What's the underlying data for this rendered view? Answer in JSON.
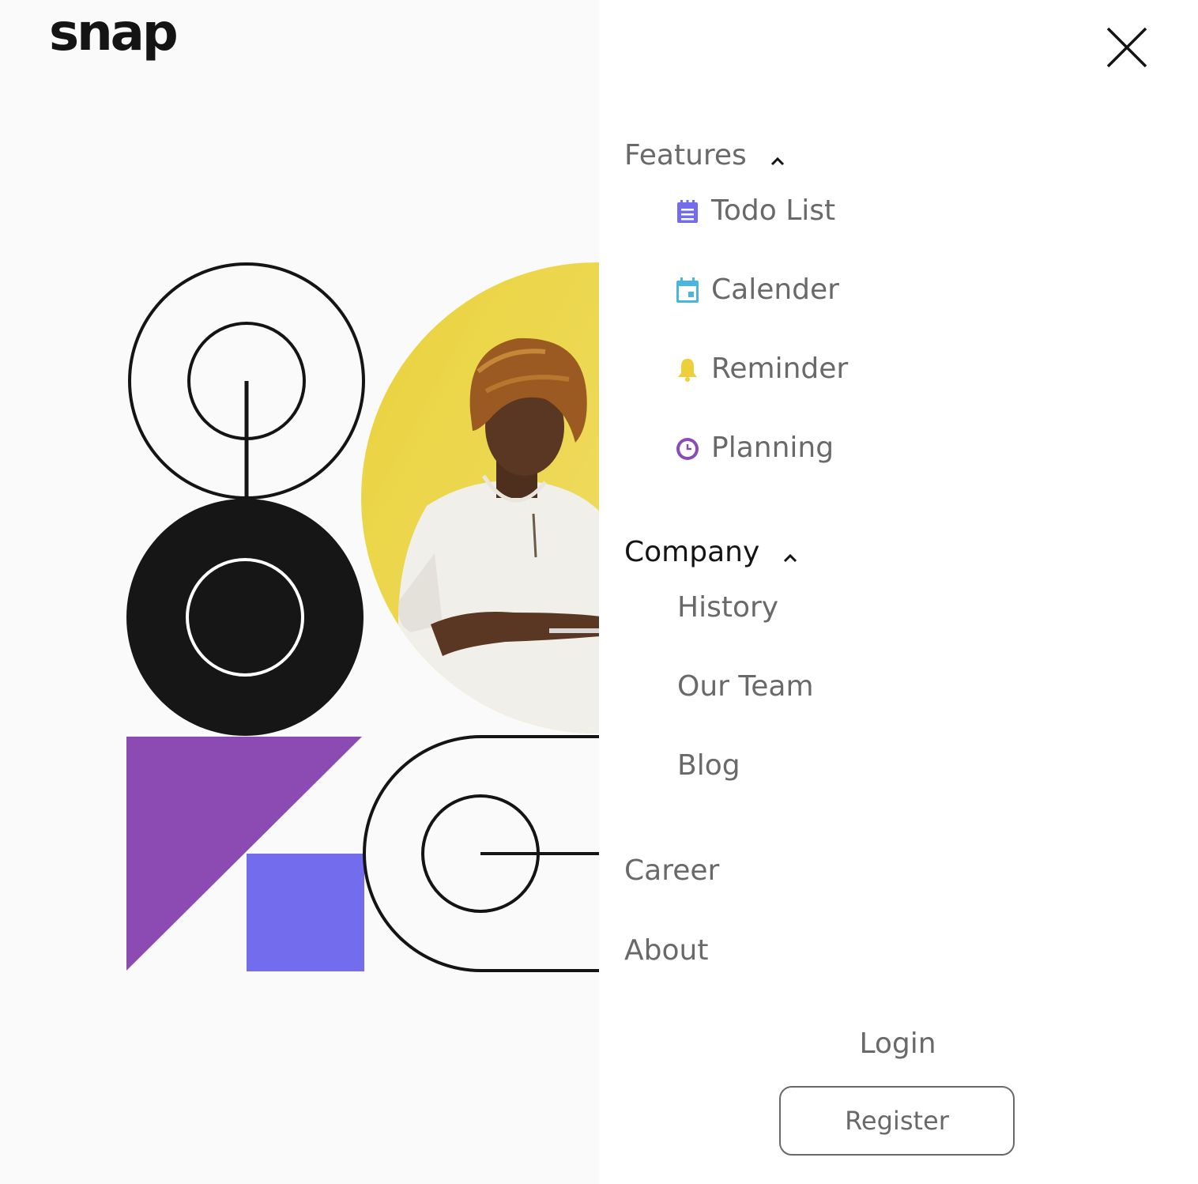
{
  "brand": {
    "logo_text": "snap"
  },
  "icons": {
    "close": "close-icon",
    "chevron": "chevron-up-icon",
    "todo": "todo-list-icon",
    "calendar": "calendar-icon",
    "reminder": "bell-icon",
    "planning": "clock-icon"
  },
  "colors": {
    "accent_purple": "#8c4bb3",
    "accent_blue": "#736cec",
    "accent_yellow": "#eccf3a",
    "calendar_blue": "#4bb6dc",
    "text_gray": "#696969",
    "text_dark": "#141414"
  },
  "menu": {
    "features": {
      "label": "Features",
      "items": [
        {
          "label": "Todo List"
        },
        {
          "label": "Calender"
        },
        {
          "label": "Reminder"
        },
        {
          "label": "Planning"
        }
      ]
    },
    "company": {
      "label": "Company",
      "items": [
        {
          "label": "History"
        },
        {
          "label": "Our Team"
        },
        {
          "label": "Blog"
        }
      ]
    },
    "career": "Career",
    "about": "About"
  },
  "auth": {
    "login": "Login",
    "register": "Register"
  }
}
